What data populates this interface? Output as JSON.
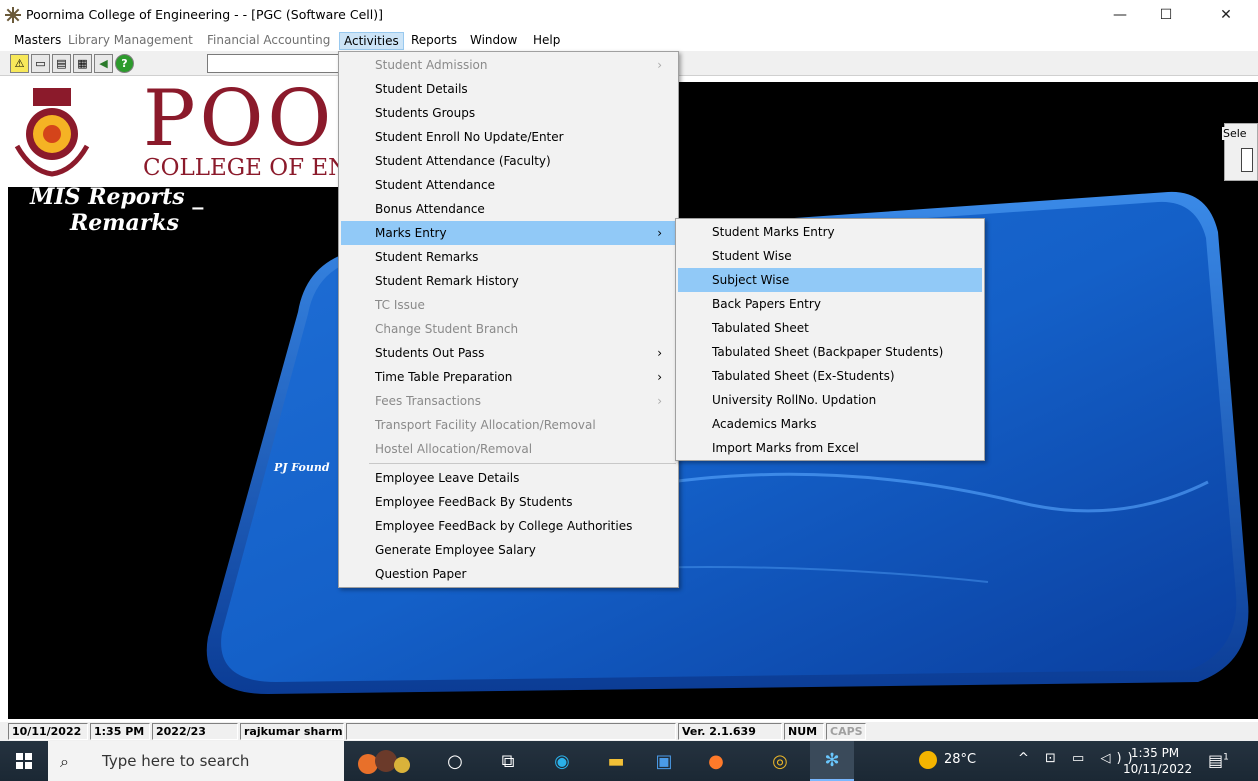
{
  "window": {
    "title": "Poornima College of Engineering -  - [PGC (Software Cell)]",
    "controls": {
      "minimize": "—",
      "maximize": "☐",
      "close": "✕"
    }
  },
  "menubar": [
    {
      "label": "Masters",
      "disabled": false
    },
    {
      "label": "Library Management",
      "disabled": true
    },
    {
      "label": "Financial Accounting",
      "disabled": true
    },
    {
      "label": "Activities",
      "disabled": false,
      "active": true
    },
    {
      "label": "Reports",
      "disabled": false
    },
    {
      "label": "Window",
      "disabled": false
    },
    {
      "label": "Help",
      "disabled": false
    }
  ],
  "toolbar": {
    "buttons": [
      "warning-icon",
      "key-icon",
      "card-icon",
      "grid-icon",
      "exit-icon",
      "help-icon"
    ],
    "combo_value": ""
  },
  "banner": {
    "logo_big": "POORI",
    "logo_sub": "COLLEGE OF EN",
    "mis_line1": "MIS Reports _",
    "mis_line2": "Remarks",
    "footer_text": "PJ Found",
    "right_group_label": "Sele"
  },
  "activities_menu": [
    {
      "label": "Student Admission",
      "disabled": true,
      "submenu": true
    },
    {
      "label": "Student Details",
      "disabled": false
    },
    {
      "label": "Students Groups",
      "disabled": false
    },
    {
      "label": "Student Enroll No Update/Enter",
      "disabled": false
    },
    {
      "label": "Student Attendance (Faculty)",
      "disabled": false
    },
    {
      "label": "Student Attendance",
      "disabled": false
    },
    {
      "label": "Bonus Attendance",
      "disabled": false
    },
    {
      "label": "Marks Entry",
      "disabled": false,
      "submenu": true,
      "highlighted": true
    },
    {
      "label": "Student Remarks",
      "disabled": false
    },
    {
      "label": "Student Remark History",
      "disabled": false
    },
    {
      "label": "TC Issue",
      "disabled": true
    },
    {
      "label": "Change Student Branch",
      "disabled": true
    },
    {
      "label": "Students Out Pass",
      "disabled": false,
      "submenu": true
    },
    {
      "label": "Time Table Preparation",
      "disabled": false,
      "submenu": true
    },
    {
      "label": "Fees Transactions",
      "disabled": true,
      "submenu": true
    },
    {
      "label": "Transport Facility Allocation/Removal",
      "disabled": true
    },
    {
      "label": "Hostel Allocation/Removal",
      "disabled": true
    },
    {
      "label": "Employee Leave Details",
      "disabled": false
    },
    {
      "label": "Employee FeedBack By Students",
      "disabled": false
    },
    {
      "label": "Employee FeedBack by College Authorities",
      "disabled": false
    },
    {
      "label": "Generate Employee Salary",
      "disabled": false
    },
    {
      "label": "Question Paper",
      "disabled": false
    }
  ],
  "marks_menu": [
    {
      "label": "Student Marks Entry"
    },
    {
      "label": "Student Wise"
    },
    {
      "label": "Subject Wise",
      "highlighted": true
    },
    {
      "label": "Back Papers Entry"
    },
    {
      "label": "Tabulated Sheet"
    },
    {
      "label": "Tabulated Sheet (Backpaper Students)"
    },
    {
      "label": "Tabulated Sheet (Ex-Students)"
    },
    {
      "label": "University RollNo. Updation"
    },
    {
      "label": "Academics Marks"
    },
    {
      "label": "Import Marks from Excel"
    }
  ],
  "statusbar": {
    "date": "10/11/2022",
    "time": "1:35 PM",
    "session": "2022/23",
    "user": "rajkumar sharm",
    "version": "Ver. 2.1.639",
    "num": "NUM",
    "caps": "CAPS"
  },
  "taskbar": {
    "search_placeholder": "Type here to search",
    "weather": "28°C",
    "tray": "^ ⊡ ▭ ◁))",
    "clock_time": "1:35 PM",
    "clock_date": "10/11/2022",
    "notification_count": "1"
  }
}
